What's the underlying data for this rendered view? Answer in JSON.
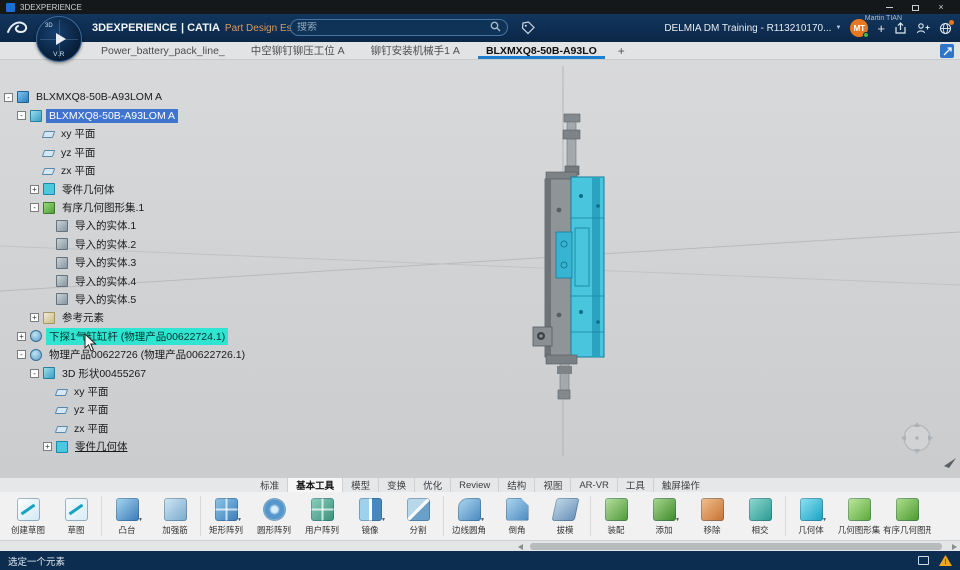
{
  "titlebar": {
    "title": "3DEXPERIENCE"
  },
  "icons": {
    "close": "×",
    "caret_down": "▼",
    "plus": "+",
    "dropdown": "▼",
    "warning": "!"
  },
  "header": {
    "brand": "3DEXPERIENCE",
    "app": "| CATIA",
    "edition": "Part Design Essentials",
    "compass_top": "3D",
    "compass_bottom": "V.R",
    "search_placeholder": "搜索",
    "user": "Martin TIAN",
    "collab": "DELMIA DM Training - R113210170...",
    "avatar": "MT"
  },
  "tabs": {
    "items": [
      {
        "label": "Power_battery_pack_line_",
        "active": false
      },
      {
        "label": "中空铆钉铆压工位 A",
        "active": false
      },
      {
        "label": "铆钉安装机械手1 A",
        "active": false
      },
      {
        "label": "BLXMXQ8-50B-A93LO",
        "active": true
      }
    ],
    "add": "+"
  },
  "tree": {
    "items": [
      {
        "label": "BLXMXQ8-50B-A93LOM A",
        "level": 0,
        "icon": "product",
        "exp": "minus",
        "state": "normal"
      },
      {
        "label": "BLXMXQ8-50B-A93LOM A",
        "level": 1,
        "icon": "shape",
        "exp": "minus",
        "state": "selected"
      },
      {
        "label": "xy 平面",
        "level": 2,
        "icon": "plane",
        "exp": "none",
        "state": "normal"
      },
      {
        "label": "yz 平面",
        "level": 2,
        "icon": "plane",
        "exp": "none",
        "state": "normal"
      },
      {
        "label": "zx 平面",
        "level": 2,
        "icon": "plane",
        "exp": "none",
        "state": "normal"
      },
      {
        "label": "零件几何体",
        "level": 2,
        "icon": "body",
        "exp": "plus",
        "state": "normal"
      },
      {
        "label": "有序几何图形集.1",
        "level": 2,
        "icon": "ogs",
        "exp": "minus",
        "state": "normal"
      },
      {
        "label": "导入的实体.1",
        "level": 3,
        "icon": "solid",
        "exp": "none",
        "state": "normal"
      },
      {
        "label": "导入的实体.2",
        "level": 3,
        "icon": "solid",
        "exp": "none",
        "state": "normal"
      },
      {
        "label": "导入的实体.3",
        "level": 3,
        "icon": "solid",
        "exp": "none",
        "state": "normal"
      },
      {
        "label": "导入的实体.4",
        "level": 3,
        "icon": "solid",
        "exp": "none",
        "state": "normal"
      },
      {
        "label": "导入的实体.5",
        "level": 3,
        "icon": "solid",
        "exp": "none",
        "state": "normal"
      },
      {
        "label": "参考元素",
        "level": 2,
        "icon": "ref",
        "exp": "plus",
        "state": "normal"
      },
      {
        "label": "下探1气缸缸杆 (物理产品00622724.1)",
        "level": 1,
        "icon": "part",
        "exp": "plus",
        "state": "prehighlight"
      },
      {
        "label": "物理产品00622726 (物理产品00622726.1)",
        "level": 1,
        "icon": "part",
        "exp": "minus",
        "state": "normal"
      },
      {
        "label": "3D 形状00455267",
        "level": 2,
        "icon": "shape",
        "exp": "minus",
        "state": "normal"
      },
      {
        "label": "xy 平面",
        "level": 3,
        "icon": "plane",
        "exp": "none",
        "state": "normal"
      },
      {
        "label": "yz 平面",
        "level": 3,
        "icon": "plane",
        "exp": "none",
        "state": "normal"
      },
      {
        "label": "zx 平面",
        "level": 3,
        "icon": "plane",
        "exp": "none",
        "state": "normal"
      },
      {
        "label": "零件几何体",
        "level": 3,
        "icon": "body",
        "exp": "plus",
        "state": "underline"
      }
    ]
  },
  "ribbon": {
    "tabs": [
      {
        "label": "标准",
        "active": false
      },
      {
        "label": "基本工具",
        "active": true
      },
      {
        "label": "模型",
        "active": false
      },
      {
        "label": "变换",
        "active": false
      },
      {
        "label": "优化",
        "active": false
      },
      {
        "label": "Review",
        "active": false
      },
      {
        "label": "结构",
        "active": false
      },
      {
        "label": "视图",
        "active": false
      },
      {
        "label": "AR-VR",
        "active": false
      },
      {
        "label": "工具",
        "active": false
      },
      {
        "label": "触屏操作",
        "active": false
      }
    ],
    "tools": [
      {
        "label": "创建草图",
        "icon": "sketch-create",
        "dd": false
      },
      {
        "label": "草图",
        "icon": "sketch",
        "dd": false
      },
      {
        "label": "凸台",
        "icon": "pad",
        "dd": true
      },
      {
        "label": "加强筋",
        "icon": "rib",
        "dd": false
      },
      {
        "label": "矩形阵列",
        "icon": "pattern-rect",
        "dd": true
      },
      {
        "label": "圆形阵列",
        "icon": "pattern-circ",
        "dd": false
      },
      {
        "label": "用户阵列",
        "icon": "pattern-user",
        "dd": false
      },
      {
        "label": "镜像",
        "icon": "mirror",
        "dd": true
      },
      {
        "label": "分割",
        "icon": "split",
        "dd": false
      },
      {
        "label": "边线圆角",
        "icon": "fillet",
        "dd": true
      },
      {
        "label": "倒角",
        "icon": "chamfer",
        "dd": false
      },
      {
        "label": "拔模",
        "icon": "draft",
        "dd": false
      },
      {
        "label": "装配",
        "icon": "assemble",
        "dd": false
      },
      {
        "label": "添加",
        "icon": "add",
        "dd": true
      },
      {
        "label": "移除",
        "icon": "remove",
        "dd": false
      },
      {
        "label": "相交",
        "icon": "intersect",
        "dd": false
      },
      {
        "label": "几何体",
        "icon": "body",
        "dd": true
      },
      {
        "label": "几何图形集",
        "icon": "geoset",
        "dd": false
      },
      {
        "label": "有序几何图形集",
        "icon": "ogs",
        "dd": false
      }
    ]
  },
  "statusbar": {
    "message": "选定一个元素"
  },
  "colors": {
    "accent_blue": "#1b7fd4",
    "selection_blue": "#3f74cf",
    "highlight_cyan": "#2fe4d0",
    "header_navy": "#0d2c50",
    "model_cyan": "#49c5de",
    "avatar_orange": "#e87722",
    "warning_orange": "#f2a71b"
  }
}
